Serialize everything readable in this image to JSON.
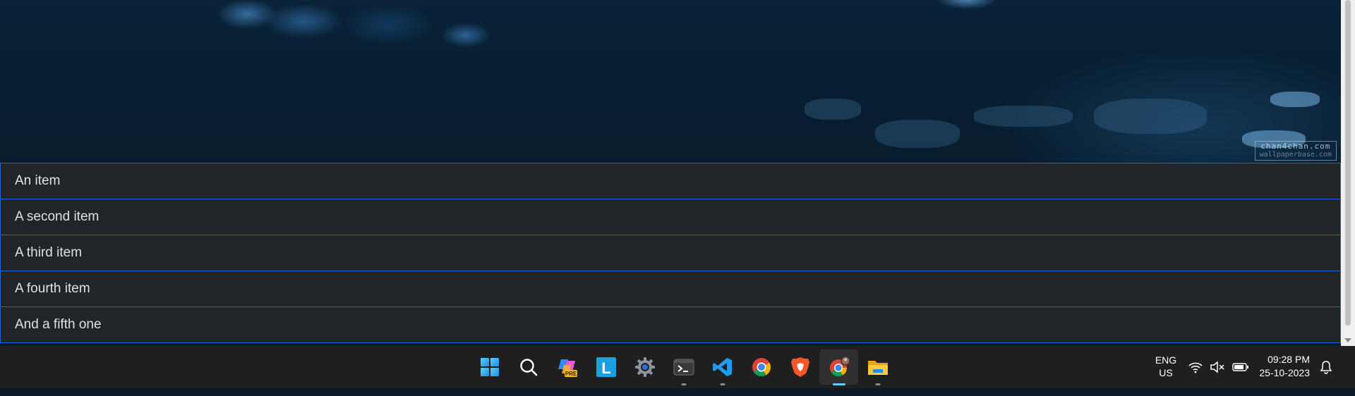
{
  "watermark": {
    "line1": "chan4chan.com",
    "line2": "wallpaperbase.com"
  },
  "list": {
    "items": [
      {
        "label": "An item"
      },
      {
        "label": "A second item"
      },
      {
        "label": "A third item"
      },
      {
        "label": "A fourth item"
      },
      {
        "label": "And a fifth one"
      }
    ]
  },
  "taskbar": {
    "icons": [
      {
        "name": "windows-start-icon"
      },
      {
        "name": "search-icon"
      },
      {
        "name": "copilot-icon",
        "badge": "PRE"
      },
      {
        "name": "launcher-l-icon",
        "letter": "L"
      },
      {
        "name": "settings-gear-icon"
      },
      {
        "name": "terminal-icon"
      },
      {
        "name": "vscode-icon"
      },
      {
        "name": "chrome-icon"
      },
      {
        "name": "brave-icon"
      },
      {
        "name": "chrome-profile-icon"
      },
      {
        "name": "file-explorer-icon"
      }
    ],
    "language": {
      "line1": "ENG",
      "line2": "US"
    },
    "clock": {
      "time": "09:28 PM",
      "date": "25-10-2023"
    }
  },
  "colors": {
    "accent": "#1e64d8",
    "list_bg": "#212529",
    "taskbar_bg": "#1f1f1f",
    "active_indicator": "#60cdff"
  }
}
